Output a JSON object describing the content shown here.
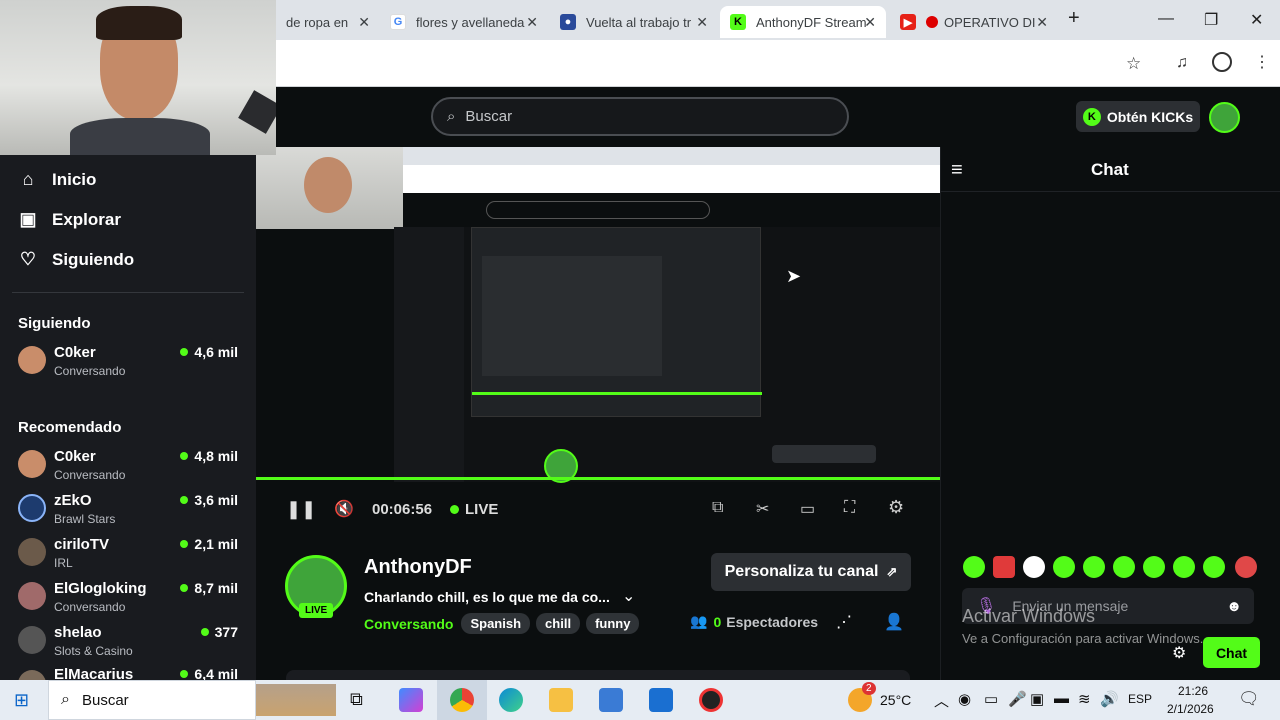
{
  "browser": {
    "tabs": [
      {
        "title": "de ropa en",
        "color": "#ffffff"
      },
      {
        "title": "flores y avellaneda",
        "icon": "google-icon"
      },
      {
        "title": "Vuelta al trabajo tr",
        "icon": "globe-icon"
      },
      {
        "title": "AnthonyDF Stream",
        "icon": "kick-icon",
        "active": true
      },
      {
        "title": "OPERATIVO DI",
        "icon": "youtube-icon"
      }
    ],
    "new_tab_label": "+"
  },
  "kick": {
    "search_placeholder": "Buscar",
    "kicks_button": "Obtén KICKs",
    "nav": [
      {
        "label": "Inicio",
        "icon": "home-icon"
      },
      {
        "label": "Explorar",
        "icon": "explore-icon"
      },
      {
        "label": "Siguiendo",
        "icon": "heart-icon"
      }
    ],
    "following_title": "Siguiendo",
    "following": [
      {
        "name": "C0ker",
        "category": "Conversando",
        "viewers": "4,6 mil"
      }
    ],
    "recommended_title": "Recomendado",
    "recommended": [
      {
        "name": "C0ker",
        "category": "Conversando",
        "viewers": "4,8 mil"
      },
      {
        "name": "zEkO",
        "category": "Brawl Stars",
        "viewers": "3,6 mil"
      },
      {
        "name": "ciriloTV",
        "category": "IRL",
        "viewers": "2,1 mil"
      },
      {
        "name": "ElGlogloking",
        "category": "Conversando",
        "viewers": "8,7 mil"
      },
      {
        "name": "shelao",
        "category": "Slots & Casino",
        "viewers": "377"
      },
      {
        "name": "ElMacarius",
        "category": "",
        "viewers": "6,4 mil"
      }
    ],
    "player": {
      "time": "00:06:56",
      "live": "LIVE"
    },
    "channel": {
      "name": "AnthonyDF",
      "live_badge": "LIVE",
      "title": "Charlando chill, es lo que me da co...",
      "category": "Conversando",
      "tags": [
        "Spanish",
        "chill",
        "funny"
      ],
      "customize": "Personaliza tu canal",
      "viewers_count": "0",
      "viewers_label": "Espectadores"
    },
    "chat": {
      "title": "Chat",
      "placeholder": "Enviar un mensaje",
      "send": "Chat",
      "watermark_title": "Activar Windows",
      "watermark_sub": "Ve a Configuración para activar Windows."
    }
  },
  "taskbar": {
    "search": "Buscar",
    "temperature": "25°C",
    "language": "ESP",
    "time": "21:26",
    "date": "2/1/2026",
    "weather_badge": "2"
  },
  "colors": {
    "kick_green": "#53fc18",
    "bg": "#0b0e0f",
    "sidebar": "#191b1f"
  }
}
